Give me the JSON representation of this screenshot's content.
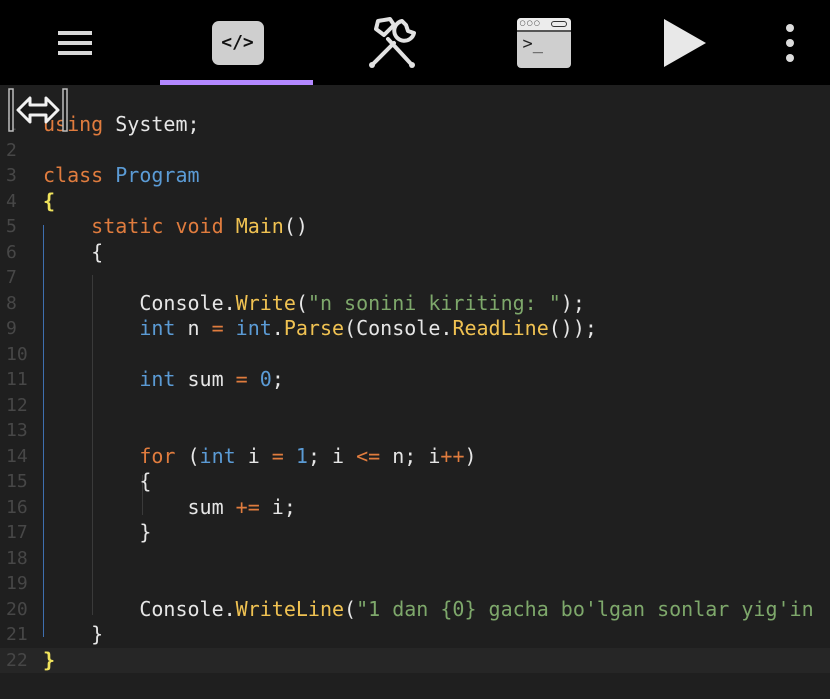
{
  "toolbar": {
    "items": [
      {
        "name": "menu-icon"
      },
      {
        "name": "code-icon",
        "label": "</>"
      },
      {
        "name": "tools-icon"
      },
      {
        "name": "terminal-icon",
        "label": ">_"
      },
      {
        "name": "run-icon"
      },
      {
        "name": "more-options-icon"
      }
    ],
    "active_tab": "code"
  },
  "editor": {
    "current_line": 22,
    "lines": [
      {
        "n": "1",
        "text": "using System;"
      },
      {
        "n": "2",
        "text": ""
      },
      {
        "n": "3",
        "text": "class Program"
      },
      {
        "n": "4",
        "text": "{"
      },
      {
        "n": "5",
        "text": "    static void Main()"
      },
      {
        "n": "6",
        "text": "    {"
      },
      {
        "n": "7",
        "text": ""
      },
      {
        "n": "8",
        "text": "        Console.Write(\"n sonini kiriting: \");"
      },
      {
        "n": "9",
        "text": "        int n = int.Parse(Console.ReadLine());"
      },
      {
        "n": "10",
        "text": ""
      },
      {
        "n": "11",
        "text": "        int sum = 0;"
      },
      {
        "n": "12",
        "text": ""
      },
      {
        "n": "13",
        "text": ""
      },
      {
        "n": "14",
        "text": "        for (int i = 1; i <= n; i++)"
      },
      {
        "n": "15",
        "text": "        {"
      },
      {
        "n": "16",
        "text": "            sum += i;"
      },
      {
        "n": "17",
        "text": "        }"
      },
      {
        "n": "18",
        "text": ""
      },
      {
        "n": "19",
        "text": ""
      },
      {
        "n": "20",
        "text": "        Console.WriteLine(\"1 dan {0} gacha bo'lgan sonlar yig'in"
      },
      {
        "n": "21",
        "text": "    }"
      },
      {
        "n": "22",
        "text": "}"
      }
    ]
  },
  "colors": {
    "keyword": "#e07c3e",
    "type": "#5b9bd5",
    "method": "#f0c252",
    "string": "#7ea86b",
    "accent": "#b388ff"
  }
}
